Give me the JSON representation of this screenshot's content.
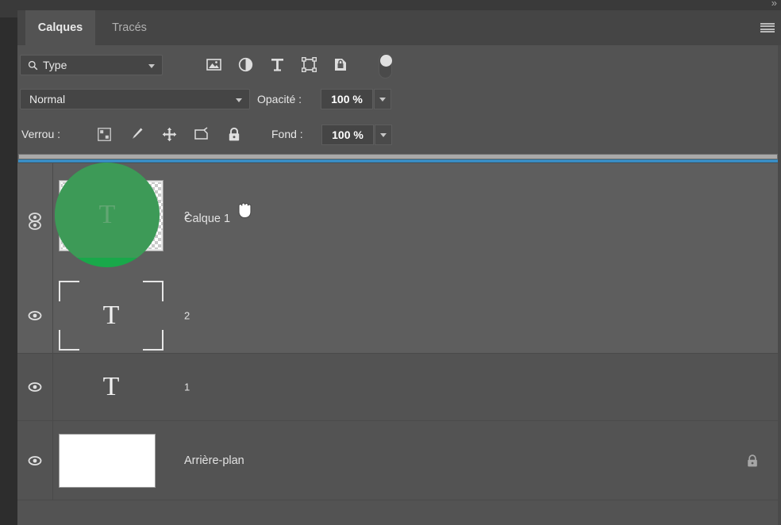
{
  "window": {
    "collapse_chevrons": "»"
  },
  "tabs": [
    {
      "label": "Calques",
      "active": true
    },
    {
      "label": "Tracés",
      "active": false
    }
  ],
  "panel_menu": {
    "icon": "hamburger-menu-icon"
  },
  "filter_row": {
    "filter_type_label": "Type",
    "search_icon": "search-icon",
    "dropdown_caret": "chevron-down-icon",
    "filter_icons": [
      {
        "name": "pixel-layers-filter-icon",
        "title": "Pixels"
      },
      {
        "name": "adjustment-layers-filter-icon",
        "title": "Réglage"
      },
      {
        "name": "type-layers-filter-icon",
        "title": "Texte"
      },
      {
        "name": "shape-layers-filter-icon",
        "title": "Forme"
      },
      {
        "name": "smart-object-filter-icon",
        "title": "Objet dynamique"
      }
    ],
    "toggle": {
      "name": "filter-enable-toggle",
      "state": "on"
    }
  },
  "blend_row": {
    "blend_mode": "Normal",
    "opacity_label": "Opacité :",
    "opacity_value": "100 %"
  },
  "lock_row": {
    "lock_label": "Verrou :",
    "lock_icons": [
      {
        "name": "lock-transparent-pixels-icon"
      },
      {
        "name": "lock-image-pixels-icon"
      },
      {
        "name": "lock-position-icon"
      },
      {
        "name": "lock-artboard-nesting-icon"
      },
      {
        "name": "lock-all-icon"
      }
    ],
    "fill_label": "Fond :",
    "fill_value": "100 %"
  },
  "drag_state": {
    "active": true,
    "drop_indicator_color": "#3d93cc",
    "ghost_color": "#19a84a",
    "ghost_label": "2",
    "cursor": "grabbing-hand-cursor"
  },
  "layers": [
    {
      "name": "Calque 1",
      "dragged_label": "2",
      "visible": true,
      "selected": true,
      "thumb_type": "type-transparent",
      "thumb_glyph": "T",
      "locked": false,
      "eye_icon": "eye-visible-icon"
    },
    {
      "name": "2",
      "visible": true,
      "selected": true,
      "thumb_type": "type-brackets",
      "thumb_glyph": "T",
      "locked": false,
      "eye_icon": "eye-visible-icon"
    },
    {
      "name": "1",
      "visible": true,
      "selected": false,
      "thumb_type": "type-plain",
      "thumb_glyph": "T",
      "locked": false,
      "eye_icon": "eye-visible-icon"
    },
    {
      "name": "Arrière-plan",
      "visible": true,
      "selected": false,
      "thumb_type": "solid-white",
      "thumb_glyph": "",
      "locked": true,
      "eye_icon": "eye-visible-icon",
      "lock_icon": "padlock-icon"
    }
  ],
  "colors": {
    "panel_bg": "#535353",
    "tabbar_bg": "#454545",
    "selected_row": "#5e5e5e",
    "accent_blue": "#3d93cc",
    "ghost_green": "#19a84a",
    "text": "#e2e2e2"
  }
}
